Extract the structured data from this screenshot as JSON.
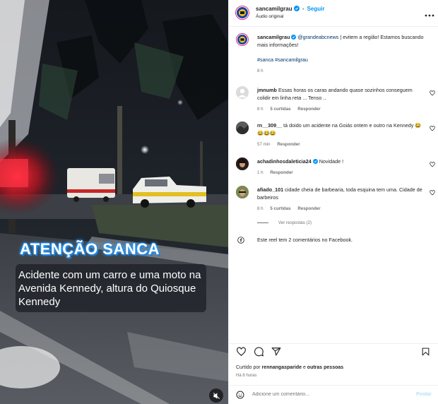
{
  "post": {
    "author": "sancamilgrau",
    "follow_label": "Seguir",
    "audio": "Áudio original",
    "dot_separator": "•"
  },
  "video": {
    "title_overlay": "ATENÇÃO SANCA",
    "caption": "Acidente com um carro e uma moto na Avenida Kennedy, altura do Quiosque Kennedy"
  },
  "caption_comment": {
    "user": "sancamilgrau",
    "mention": "@grandeabcnews",
    "text": " | evitem a região! Estamos buscando mais informações!",
    "hashtags": "#sanca #sancamilgrau",
    "time": "8 h"
  },
  "comments": [
    {
      "user": "jmnumb",
      "text": "Essas horas os caras andando quase sozinhos conseguem colidir em linha reta ... Tenso ..",
      "time": "8 h",
      "likes": "5 curtidas",
      "reply": "Responder"
    },
    {
      "user": "rn__309__",
      "text": "tá doido um acidente na Goiás ontem e outro na Kennedy 😂😂😂😂",
      "time": "57 min",
      "likes": "",
      "reply": "Responder"
    },
    {
      "user": "achadinhosdaleticia24",
      "text": "Novidade !",
      "time": "1 h",
      "likes": "",
      "reply": "Responder"
    },
    {
      "user": "afiado_101",
      "text": "cidade cheia de barbearia, toda esquina tem uma. Cidade de barbeiros",
      "time": "8 h",
      "likes": "5 curtidas",
      "reply": "Responder"
    }
  ],
  "view_replies": "Ver respostas (2)",
  "facebook_note": "Este reel tem 2 comentários no Facebook.",
  "likes_line": {
    "prefix": "Curtido por ",
    "user": "rennangasparide",
    "middle": " e ",
    "others": "outras pessoas"
  },
  "posted_ago": "Há 8 horas",
  "composer": {
    "placeholder": "Adicione um comentário...",
    "post_label": "Postar"
  },
  "colors": {
    "accent": "#0095f6",
    "verified": "#0095f6",
    "story_ring": "#d82d7e"
  },
  "icons": [
    "heart-icon",
    "comment-icon",
    "share-icon",
    "bookmark-icon",
    "emoji-icon",
    "facebook-icon",
    "more-icon",
    "verified-icon",
    "mute-icon"
  ]
}
